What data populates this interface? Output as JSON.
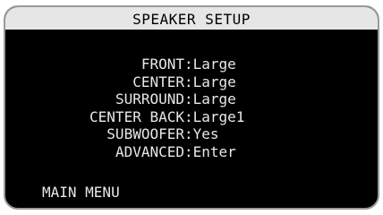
{
  "title": "SPEAKER SETUP",
  "items": [
    {
      "label": "FRONT",
      "value": "Large"
    },
    {
      "label": "CENTER",
      "value": "Large"
    },
    {
      "label": "SURROUND",
      "value": "Large"
    },
    {
      "label": "CENTER BACK",
      "value": "Large1"
    },
    {
      "label": "SUBWOOFER",
      "value": "Yes"
    },
    {
      "label": "ADVANCED",
      "value": "Enter"
    }
  ],
  "separator": ":",
  "footer": "MAIN MENU",
  "colors": {
    "screen_bg": "#000000",
    "title_bg": "#e6e6e6",
    "text": "#e8e8e8",
    "frame": "#9a9a9a"
  }
}
